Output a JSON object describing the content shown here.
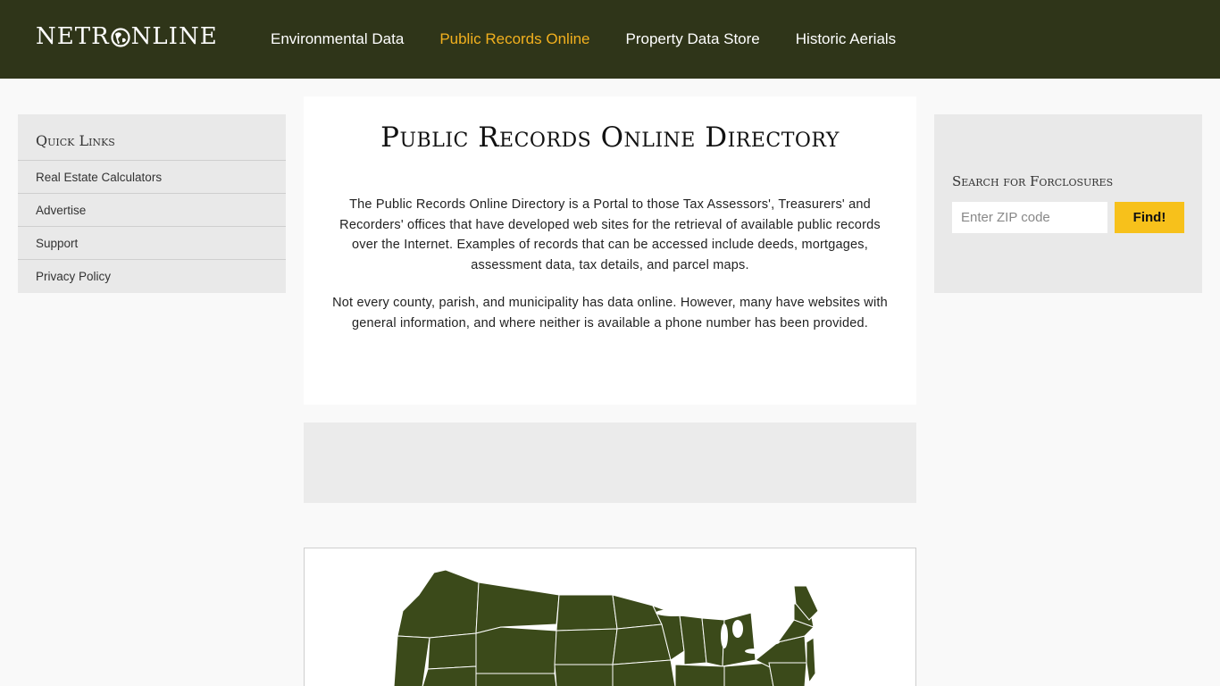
{
  "header": {
    "logo_left": "NETR",
    "logo_right": "NLINE",
    "nav": [
      {
        "label": "Environmental Data",
        "active": false
      },
      {
        "label": "Public Records Online",
        "active": true
      },
      {
        "label": "Property Data Store",
        "active": false
      },
      {
        "label": "Historic Aerials",
        "active": false
      }
    ]
  },
  "sidebar": {
    "title": "Quick Links",
    "links": [
      "Real Estate Calculators",
      "Advertise",
      "Support",
      "Privacy Policy"
    ]
  },
  "intro": {
    "title": "Public Records Online Directory",
    "paragraph1": "The Public Records Online Directory is a Portal to those Tax Assessors', Treasurers' and Recorders' offices that have developed web sites for the retrieval of available public records over the Internet. Examples of records that can be accessed include deeds, mortgages, assessment data, tax details, and parcel maps.",
    "paragraph2": "Not every county, parish, and municipality has data online. However, many have websites with general information, and where neither is available a phone number has been provided."
  },
  "search": {
    "title": "Search for Forclosures",
    "placeholder": "Enter ZIP code",
    "button_label": "Find!"
  },
  "colors": {
    "header_bg": "#2f3519",
    "accent": "#f2b01e",
    "button": "#f7c11b",
    "map_fill": "#3b4a1a"
  },
  "icons": {
    "logo_globe": "globe-icon"
  }
}
